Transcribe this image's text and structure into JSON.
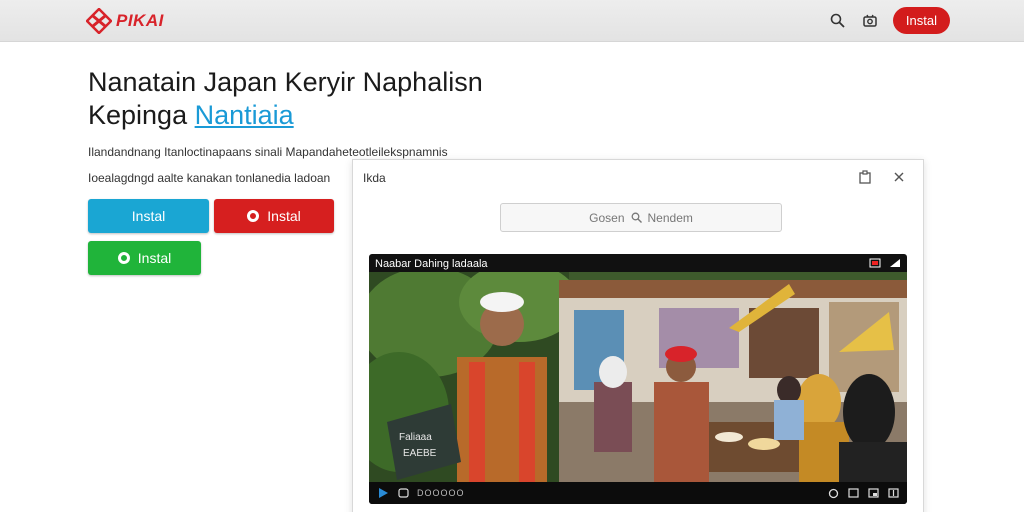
{
  "header": {
    "logo_text": "PIKAI",
    "install_label": "Instal",
    "accent": "#d31c1c"
  },
  "hero": {
    "title_line1": "Nanatain Japan Keryir Naphalisn",
    "title_line2_prefix": "Kepinga",
    "title_line2_link": "Nantiaia",
    "desc_line1": "Ilandandnang Itanloctinapaans sinali Mapandaheteotleilekspnamnis",
    "desc_line2": "Ioealagdngd aalte kanakan tonlanedia ladoan"
  },
  "buttons": {
    "blue": {
      "label": "Instal",
      "color": "#1aa6d3"
    },
    "red": {
      "label": "Instal",
      "color": "#d61f1f"
    },
    "green": {
      "label": "Instal",
      "color": "#20b43a"
    }
  },
  "modal": {
    "title": "Ikda",
    "search_placeholder": "Gosen",
    "search_text": "Nendem"
  },
  "video": {
    "title": "Naabar Dahing ladaala",
    "sign_text_1": "Faliaaa",
    "sign_text_2": "EAEBE",
    "time": "DOOOOO"
  }
}
